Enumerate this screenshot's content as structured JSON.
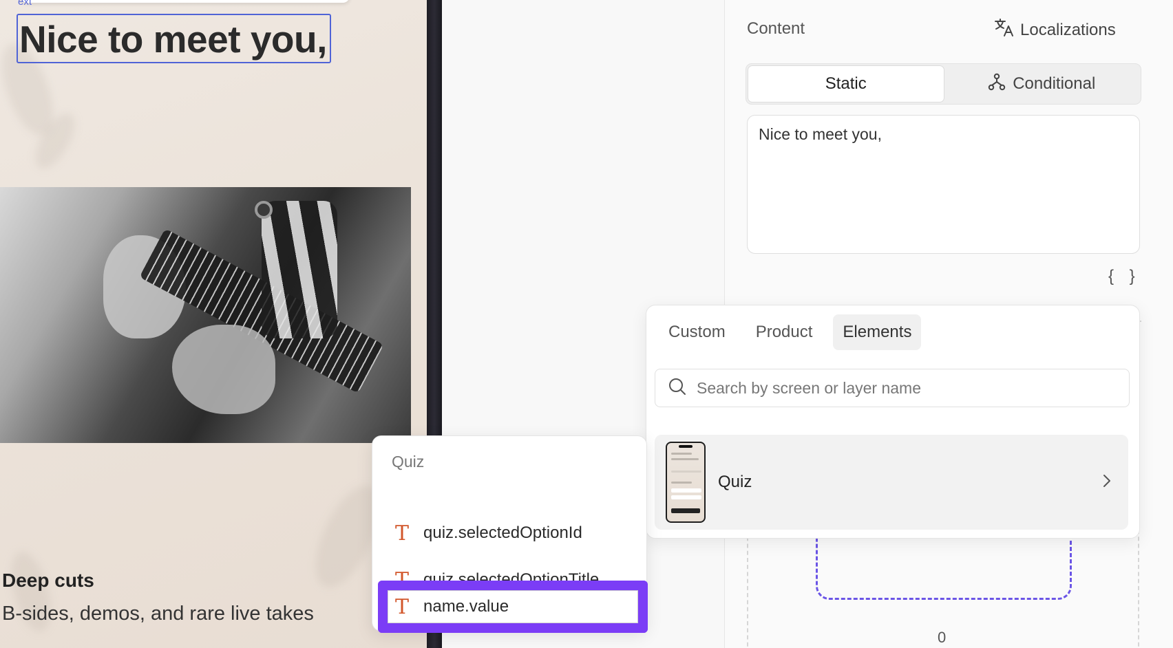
{
  "canvas": {
    "layer_tag": "ext",
    "selected_text": "Nice to meet you,",
    "card_title": "Deep cuts",
    "card_subtitle": "B-sides, demos, and rare live takes"
  },
  "inspector": {
    "section_label": "Content",
    "localizations_label": "Localizations",
    "tabs": [
      {
        "label": "Static",
        "active": true
      },
      {
        "label": "Conditional",
        "active": false
      }
    ],
    "text_value": "Nice to meet you,",
    "braces": "{ }",
    "zero_label": "0"
  },
  "variables_popover": {
    "tabs": [
      {
        "label": "Custom",
        "active": false
      },
      {
        "label": "Product",
        "active": false
      },
      {
        "label": "Elements",
        "active": true
      }
    ],
    "search_placeholder": "Search by screen or layer name",
    "screens": [
      {
        "name": "Quiz"
      }
    ]
  },
  "quiz_popover": {
    "header": "Quiz",
    "items": [
      {
        "label": "quiz.selectedOptionId",
        "icon": "text-type-icon"
      },
      {
        "label": "quiz.selectedOptionTitle",
        "icon": "text-type-icon"
      },
      {
        "label": "name.value",
        "icon": "text-type-icon",
        "highlighted": true
      }
    ]
  },
  "colors": {
    "selection_blue": "#4f63d6",
    "highlight_purple": "#7b3df6",
    "text_icon_orange": "#d2562a",
    "dashed_purple": "#6b55e6"
  }
}
